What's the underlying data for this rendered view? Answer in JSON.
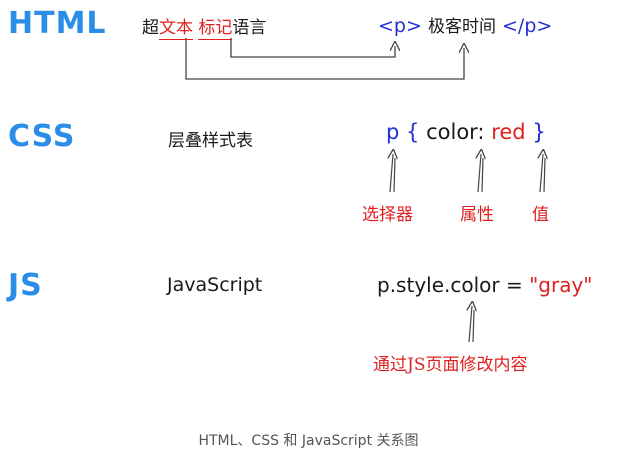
{
  "html_row": {
    "heading": "HTML",
    "term_prefix": "超",
    "term_part1": "文本",
    "term_part2": "标记",
    "term_suffix": "语言",
    "code_open": "<p>",
    "code_content": "极客时间",
    "code_close": "</p>"
  },
  "css_row": {
    "heading": "CSS",
    "term": "层叠样式表",
    "code_selector": "p",
    "code_brace_open": "{",
    "code_property": "color:",
    "code_value": "red",
    "code_brace_close": "}",
    "label_selector": "选择器",
    "label_property": "属性",
    "label_value": "值"
  },
  "js_row": {
    "heading": "JS",
    "term": "JavaScript",
    "code_statement": "p.style.color = ",
    "code_string": "\"gray\"",
    "label_note": "通过JS页面修改内容"
  },
  "caption": "HTML、CSS 和 JavaScript 关系图",
  "colors": {
    "heading": "#2a8ee8",
    "accent_red": "#e02020",
    "tag_blue": "#1f2fd6",
    "text": "#1a1a1a",
    "caption": "#555555"
  }
}
